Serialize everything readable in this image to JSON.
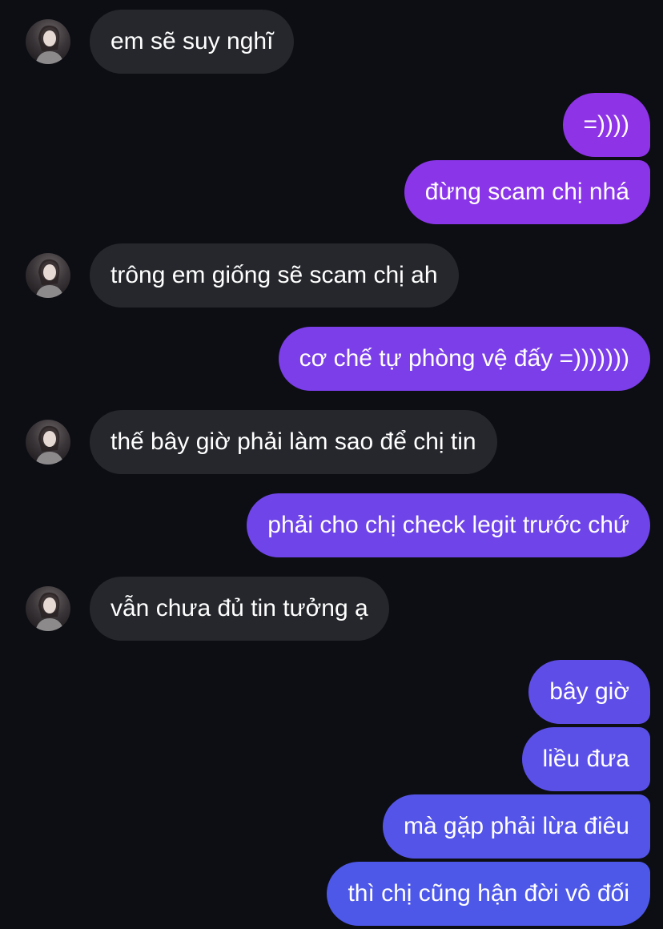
{
  "conversation": {
    "messages": [
      {
        "dir": "in",
        "text": "em sẽ suy nghĩ"
      },
      {
        "dir": "out",
        "text": "=))))",
        "color": "#8e33e6"
      },
      {
        "dir": "out",
        "text": "đừng scam chị nhá",
        "color": "#8a36e8"
      },
      {
        "dir": "in",
        "text": "trông em giống sẽ scam chị ah"
      },
      {
        "dir": "out",
        "text": "cơ chế tự phòng vệ đấy =)))))))",
        "color": "#7b3ee8"
      },
      {
        "dir": "in",
        "text": "thế bây giờ phải làm sao để chị tin"
      },
      {
        "dir": "out",
        "text": "phải cho chị check legit trước chứ",
        "color": "#6f44e8"
      },
      {
        "dir": "in",
        "text": "vẫn chưa đủ tin tưởng ạ"
      },
      {
        "dir": "out",
        "text": "bây giờ",
        "color": "#5f4de8"
      },
      {
        "dir": "out",
        "text": "liều đưa",
        "color": "#5a50e8"
      },
      {
        "dir": "out",
        "text": "mà gặp phải lừa điêu",
        "color": "#5454e8"
      },
      {
        "dir": "out",
        "text": "thì chị cũng hận đời vô đối",
        "color": "#4d58e8"
      }
    ]
  },
  "theme": {
    "background": "#0c0e13",
    "incoming_bubble": "#25272c",
    "text": "#ffffff"
  },
  "icons": {
    "avatar": "contact-avatar"
  }
}
